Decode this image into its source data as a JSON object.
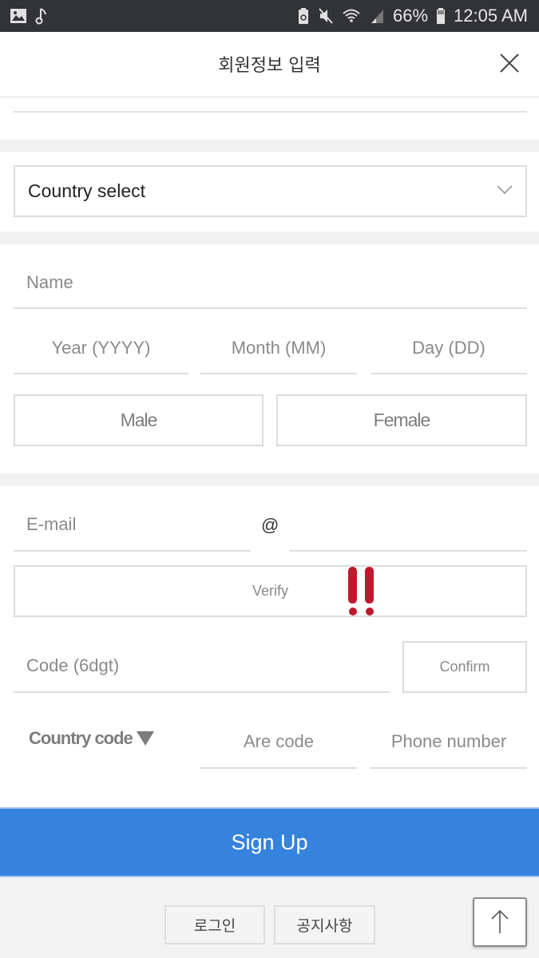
{
  "status_bar": {
    "left_icons": [
      "image-icon",
      "music-note-icon"
    ],
    "right_icons": [
      "battery-saver-icon",
      "mute-icon",
      "wifi-icon",
      "signal-icon"
    ],
    "battery_percent": "66%",
    "time": "12:05 AM"
  },
  "header": {
    "title": "회원정보 입력",
    "close_icon": "close-icon"
  },
  "country_select": {
    "label": "Country select",
    "icon": "chevron-down-icon"
  },
  "personal": {
    "name_placeholder": "Name",
    "year_placeholder": "Year (YYYY)",
    "month_placeholder": "Month (MM)",
    "day_placeholder": "Day (DD)",
    "gender_options": [
      "Male",
      "Female"
    ]
  },
  "contact": {
    "email_placeholder": "E-mail",
    "at_symbol": "@",
    "domain_placeholder": "",
    "verify_label": "Verify",
    "alert_color": "#c0182f",
    "code_placeholder": "Code (6dgt)",
    "confirm_label": "Confirm",
    "country_code_label": "Country code",
    "area_code_placeholder": "Are code",
    "phone_placeholder": "Phone number"
  },
  "signup": {
    "label": "Sign Up",
    "color": "#3583dd"
  },
  "footer": {
    "login_label": "로그인",
    "notice_label": "공지사항",
    "scroll_top_icon": "arrow-up-icon"
  }
}
